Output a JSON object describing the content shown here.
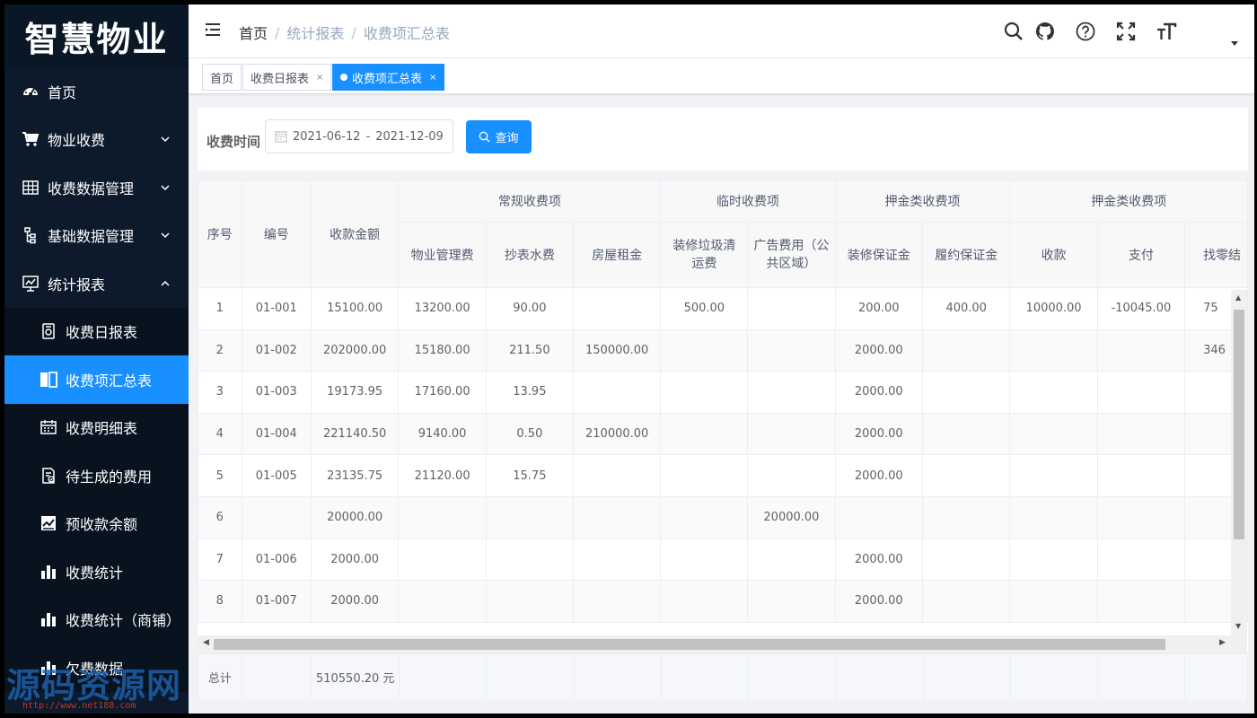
{
  "app": {
    "logo_text": "智慧物业"
  },
  "sidebar": {
    "items": [
      {
        "label": "首页",
        "icon": "dashboard-icon"
      },
      {
        "label": "物业收费",
        "icon": "cart-icon"
      },
      {
        "label": "收费数据管理",
        "icon": "table-icon"
      },
      {
        "label": "基础数据管理",
        "icon": "tree-icon"
      },
      {
        "label": "统计报表",
        "icon": "monitor-chart-icon"
      }
    ],
    "sub_items": [
      {
        "label": "收费日报表",
        "icon": "report-icon"
      },
      {
        "label": "收费项汇总表",
        "icon": "book-icon",
        "active": true
      },
      {
        "label": "收费明细表",
        "icon": "calendar-icon"
      },
      {
        "label": "待生成的费用",
        "icon": "doc-check-icon"
      },
      {
        "label": "预收款余额",
        "icon": "chart-box-icon"
      },
      {
        "label": "收费统计",
        "icon": "bar-chart-icon"
      },
      {
        "label": "收费统计（商铺）",
        "icon": "bar-chart-icon"
      },
      {
        "label": "欠费数据",
        "icon": "bar-chart-icon"
      }
    ],
    "watermark": {
      "text": "源码资源网",
      "url": "http://www.net188.com"
    }
  },
  "header": {
    "breadcrumb": [
      "首页",
      "统计报表",
      "收费项汇总表"
    ],
    "separator": "/"
  },
  "tags": [
    {
      "label": "首页"
    },
    {
      "label": "收费日报表",
      "close": "×"
    },
    {
      "label": "收费项汇总表",
      "close": "×",
      "active": true
    }
  ],
  "filter": {
    "label": "收费时间",
    "start_date": "2021-06-12",
    "end_date": "2021-12-09",
    "range_separator": "-",
    "query_label": "查询"
  },
  "table": {
    "headers": {
      "index": "序号",
      "code": "编号",
      "amount": "收款金额",
      "group_regular": "常规收费项",
      "group_temp": "临时收费项",
      "group_deposit": "押金类收费项",
      "group_deposit2": "押金类收费项",
      "property_fee": "物业管理费",
      "water_fee": "抄表水费",
      "rent": "房屋租金",
      "garbage": "装修垃圾清运费",
      "ad_fee": "广告费用（公共区域）",
      "decor_deposit": "装修保证金",
      "perf_deposit": "履约保证金",
      "receive": "收款",
      "pay": "支付",
      "change": "找零结"
    },
    "rows": [
      [
        "1",
        "01-001",
        "15100.00",
        "13200.00",
        "90.00",
        "",
        "500.00",
        "",
        "200.00",
        "400.00",
        "10000.00",
        "-10045.00",
        "75"
      ],
      [
        "2",
        "01-002",
        "202000.00",
        "15180.00",
        "211.50",
        "150000.00",
        "",
        "",
        "2000.00",
        "",
        "",
        "",
        "346"
      ],
      [
        "3",
        "01-003",
        "19173.95",
        "17160.00",
        "13.95",
        "",
        "",
        "",
        "2000.00",
        "",
        "",
        "",
        ""
      ],
      [
        "4",
        "01-004",
        "221140.50",
        "9140.00",
        "0.50",
        "210000.00",
        "",
        "",
        "2000.00",
        "",
        "",
        "",
        ""
      ],
      [
        "5",
        "01-005",
        "23135.75",
        "21120.00",
        "15.75",
        "",
        "",
        "",
        "2000.00",
        "",
        "",
        "",
        ""
      ],
      [
        "6",
        "",
        "20000.00",
        "",
        "",
        "",
        "",
        "20000.00",
        "",
        "",
        "",
        "",
        ""
      ],
      [
        "7",
        "01-006",
        "2000.00",
        "",
        "",
        "",
        "",
        "",
        "2000.00",
        "",
        "",
        "",
        ""
      ],
      [
        "8",
        "01-007",
        "2000.00",
        "",
        "",
        "",
        "",
        "",
        "2000.00",
        "",
        "",
        "",
        ""
      ]
    ],
    "footer": {
      "label": "总计",
      "total": "510550.20 元"
    }
  }
}
